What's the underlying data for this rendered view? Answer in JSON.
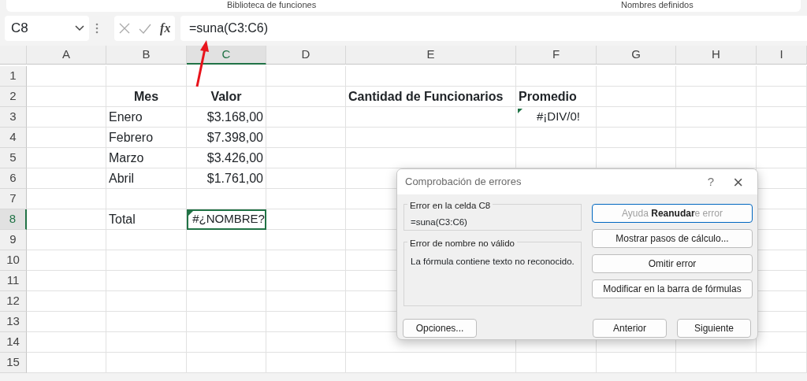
{
  "ribbon": {
    "groups": [
      "Biblioteca de funciones",
      "Nombres definidos"
    ]
  },
  "formula_bar": {
    "name_box": "C8",
    "fx": "fx",
    "formula": "=suna(C3:C6)"
  },
  "sheet": {
    "columns": [
      {
        "label": "A",
        "selected": false
      },
      {
        "label": "B",
        "selected": false
      },
      {
        "label": "C",
        "selected": true
      },
      {
        "label": "D",
        "selected": false
      },
      {
        "label": "E",
        "selected": false
      },
      {
        "label": "F",
        "selected": false
      },
      {
        "label": "G",
        "selected": false
      },
      {
        "label": "H",
        "selected": false
      },
      {
        "label": "I",
        "selected": false
      }
    ],
    "rows": [
      {
        "number": "1",
        "selected": false,
        "cells": [
          null,
          null,
          null,
          null,
          null,
          null,
          null,
          null,
          null
        ]
      },
      {
        "number": "2",
        "selected": false,
        "cells": [
          null,
          {
            "text": "Mes",
            "kind": "heading",
            "selected": false
          },
          {
            "text": "Valor",
            "kind": "heading",
            "selected": false
          },
          null,
          {
            "text": "Cantidad de Funcionarios",
            "kind": "heading_left",
            "selected": false
          },
          {
            "text": "Promedio",
            "kind": "heading_left",
            "selected": false
          },
          null,
          null,
          null
        ]
      },
      {
        "number": "3",
        "selected": false,
        "cells": [
          null,
          {
            "text": "Enero",
            "kind": "text",
            "selected": false
          },
          {
            "text": "$3.168,00",
            "kind": "number",
            "selected": false
          },
          null,
          null,
          {
            "text": "#¡DIV/0!",
            "kind": "error",
            "selected": false
          },
          null,
          null,
          null
        ]
      },
      {
        "number": "4",
        "selected": false,
        "cells": [
          null,
          {
            "text": "Febrero",
            "kind": "text",
            "selected": false
          },
          {
            "text": "$7.398,00",
            "kind": "number",
            "selected": false
          },
          null,
          null,
          null,
          null,
          null,
          null
        ]
      },
      {
        "number": "5",
        "selected": false,
        "cells": [
          null,
          {
            "text": "Marzo",
            "kind": "text",
            "selected": false
          },
          {
            "text": "$3.426,00",
            "kind": "number",
            "selected": false
          },
          null,
          null,
          null,
          null,
          null,
          null
        ]
      },
      {
        "number": "6",
        "selected": false,
        "cells": [
          null,
          {
            "text": "Abril",
            "kind": "text",
            "selected": false
          },
          {
            "text": "$1.761,00",
            "kind": "number",
            "selected": false
          },
          null,
          null,
          null,
          null,
          null,
          null
        ]
      },
      {
        "number": "7",
        "selected": false,
        "cells": [
          null,
          null,
          null,
          null,
          null,
          null,
          null,
          null,
          null
        ]
      },
      {
        "number": "8",
        "selected": true,
        "cells": [
          null,
          {
            "text": "Total",
            "kind": "text",
            "selected": false
          },
          {
            "text": "#¿NOMBRE?",
            "kind": "error",
            "selected": true
          },
          null,
          null,
          null,
          null,
          null,
          null
        ]
      },
      {
        "number": "9",
        "selected": false,
        "cells": [
          null,
          null,
          null,
          null,
          null,
          null,
          null,
          null,
          null
        ]
      },
      {
        "number": "10",
        "selected": false,
        "cells": [
          null,
          null,
          null,
          null,
          null,
          null,
          null,
          null,
          null
        ]
      },
      {
        "number": "11",
        "selected": false,
        "cells": [
          null,
          null,
          null,
          null,
          null,
          null,
          null,
          null,
          null
        ]
      },
      {
        "number": "12",
        "selected": false,
        "cells": [
          null,
          null,
          null,
          null,
          null,
          null,
          null,
          null,
          null
        ]
      },
      {
        "number": "13",
        "selected": false,
        "cells": [
          null,
          null,
          null,
          null,
          null,
          null,
          null,
          null,
          null
        ]
      },
      {
        "number": "14",
        "selected": false,
        "cells": [
          null,
          null,
          null,
          null,
          null,
          null,
          null,
          null,
          null
        ]
      },
      {
        "number": "15",
        "selected": false,
        "cells": [
          null,
          null,
          null,
          null,
          null,
          null,
          null,
          null,
          null
        ]
      }
    ]
  },
  "dialog": {
    "title": "Comprobación de errores",
    "help": "?",
    "close": "×",
    "cell_group": {
      "legend": "Error en la celda C8",
      "formula": "=suna(C3:C6)"
    },
    "error_group": {
      "legend": "Error de nombre no válido",
      "description": "La fórmula contiene texto no reconocido."
    },
    "side_buttons": [
      {
        "label": "Ayuda **Reanudar**e error",
        "focused": true
      },
      {
        "label": "Mostrar pasos de cálculo...",
        "focused": false
      },
      {
        "label": "Omitir error",
        "focused": false
      },
      {
        "label": "Modificar en la barra de fórmulas",
        "focused": false
      }
    ],
    "footer_buttons": [
      "Opciones...",
      "Anterior",
      "Siguiente"
    ]
  }
}
